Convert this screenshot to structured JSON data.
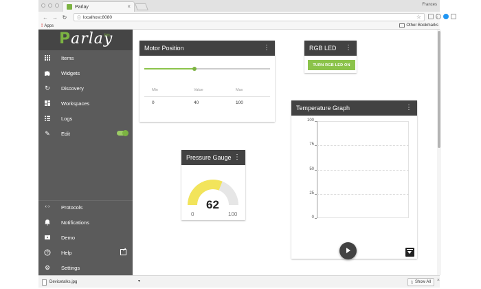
{
  "browser": {
    "tab_title": "Parlay",
    "url": "localhost:8080",
    "profile_name": "Frances",
    "apps_label": "Apps",
    "other_bookmarks_label": "Other Bookmarks"
  },
  "sidebar": {
    "logo_text": "Parlay",
    "logo_tm": "tm",
    "items": [
      {
        "label": "Items",
        "icon": "grid-icon"
      },
      {
        "label": "Widgets",
        "icon": "puzzle-icon"
      },
      {
        "label": "Discovery",
        "icon": "refresh-icon"
      },
      {
        "label": "Workspaces",
        "icon": "dashboard-icon"
      },
      {
        "label": "Logs",
        "icon": "list-icon"
      },
      {
        "label": "Edit",
        "icon": "pencil-icon"
      }
    ],
    "edit_toggle_on": true,
    "bottom_items": [
      {
        "label": "Protocols",
        "icon": "code-arrows-icon"
      },
      {
        "label": "Notifications",
        "icon": "bell-icon"
      },
      {
        "label": "Demo",
        "icon": "slideshow-icon"
      },
      {
        "label": "Help",
        "icon": "help-icon"
      },
      {
        "label": "Settings",
        "icon": "gear-icon"
      }
    ]
  },
  "widgets": {
    "motor": {
      "title": "Motor Position",
      "slider_fraction": 0.4,
      "columns": [
        "Min",
        "Value",
        "Max"
      ],
      "values": [
        "0",
        "40",
        "100"
      ]
    },
    "rgb": {
      "title": "RGB LED",
      "button_label": "TURN RGB LED ON"
    },
    "pressure": {
      "title": "Pressure Gauge",
      "value": "62",
      "min": "0",
      "max": "100",
      "fraction": 0.62
    },
    "temperature": {
      "title": "Temperature Graph"
    }
  },
  "chart_data": {
    "type": "line",
    "title": "",
    "xlabel": "",
    "ylabel": "",
    "ylim": [
      0,
      100
    ],
    "yticks": [
      "100",
      "75",
      "50",
      "25",
      "0"
    ],
    "series": []
  },
  "downloads": {
    "file_name": "Devicetalks.jpg",
    "show_all_label": "Show All"
  },
  "colors": {
    "accent": "#8bc34a",
    "sidebar_bg": "#5b5b5b",
    "card_header": "#424242",
    "gauge_fill": "#f2e45b",
    "gauge_track": "#e6e6e6"
  }
}
